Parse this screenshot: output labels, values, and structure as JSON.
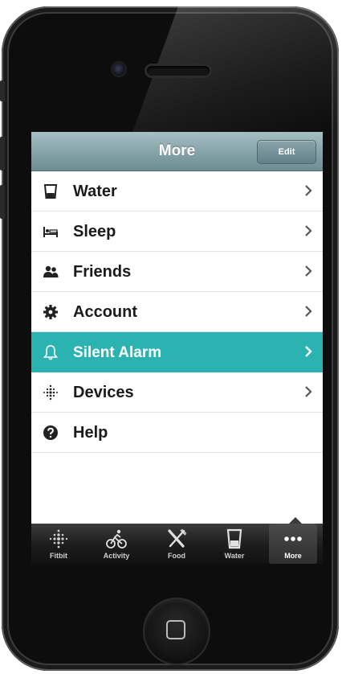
{
  "navbar": {
    "title": "More",
    "edit_label": "Edit"
  },
  "menu": [
    {
      "label": "Water",
      "icon": "water-glass-icon",
      "has_chevron": true
    },
    {
      "label": "Sleep",
      "icon": "bed-icon",
      "has_chevron": true
    },
    {
      "label": "Friends",
      "icon": "friends-icon",
      "has_chevron": true
    },
    {
      "label": "Account",
      "icon": "gear-icon",
      "has_chevron": true
    },
    {
      "label": "Silent Alarm",
      "icon": "bell-icon",
      "has_chevron": true,
      "selected": true
    },
    {
      "label": "Devices",
      "icon": "fitbit-icon",
      "has_chevron": true
    },
    {
      "label": "Help",
      "icon": "help-icon",
      "has_chevron": false
    }
  ],
  "tabbar": {
    "tabs": [
      {
        "label": "Fitbit",
        "icon": "fitbit-icon"
      },
      {
        "label": "Activity",
        "icon": "cyclist-icon"
      },
      {
        "label": "Food",
        "icon": "fork-knife-icon"
      },
      {
        "label": "Water",
        "icon": "water-glass-icon"
      },
      {
        "label": "More",
        "icon": "more-dots-icon",
        "selected": true
      }
    ]
  },
  "colors": {
    "navbar": "#86a4a9",
    "selected_row": "#2bb3b2",
    "tabbar": "#1e1e1e",
    "text": "#1a1a1a"
  }
}
